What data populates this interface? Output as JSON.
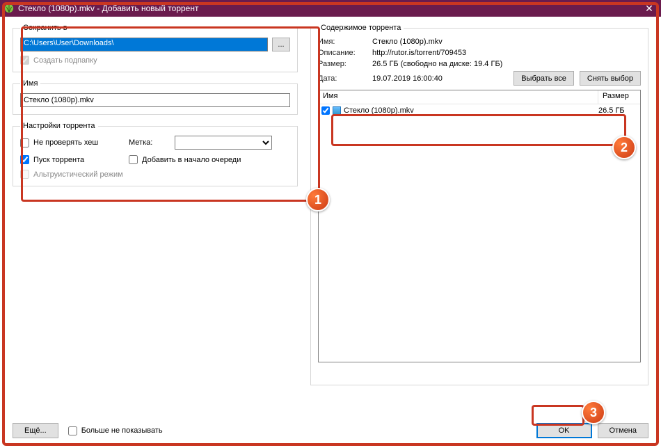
{
  "title": "Стекло (1080p).mkv - Добавить новый торрент",
  "left": {
    "save_in_legend": "Сохранить в",
    "path_value": "C:\\Users\\User\\Downloads\\",
    "browse_label": "...",
    "create_subfolder": "Создать подпапку",
    "name_legend": "Имя",
    "name_value": "Стекло (1080p).mkv",
    "settings_legend": "Настройки торрента",
    "no_hash_check": "Не проверять хеш",
    "start_torrent": "Пуск торрента",
    "altruistic": "Альтруистический режим",
    "label_text": "Метка:",
    "add_to_top": "Добавить в начало очереди"
  },
  "right": {
    "content_legend": "Содержимое торрента",
    "name_lbl": "Имя:",
    "name_val": "Стекло (1080p).mkv",
    "desc_lbl": "Описание:",
    "desc_val": "http://rutor.is/torrent/709453",
    "size_lbl": "Размер:",
    "size_val": "26.5 ГБ (свободно на диске: 19.4 ГБ)",
    "date_lbl": "Дата:",
    "date_val": "19.07.2019 16:00:40",
    "select_all": "Выбрать все",
    "deselect": "Снять выбор",
    "col_name": "Имя",
    "col_size": "Размер",
    "file_name": "Стекло (1080p).mkv",
    "file_size": "26.5 ГБ"
  },
  "footer": {
    "more": "Ещё...",
    "dont_show": "Больше не показывать",
    "ok": "OK",
    "cancel": "Отмена"
  },
  "badges": {
    "b1": "1",
    "b2": "2",
    "b3": "3"
  }
}
